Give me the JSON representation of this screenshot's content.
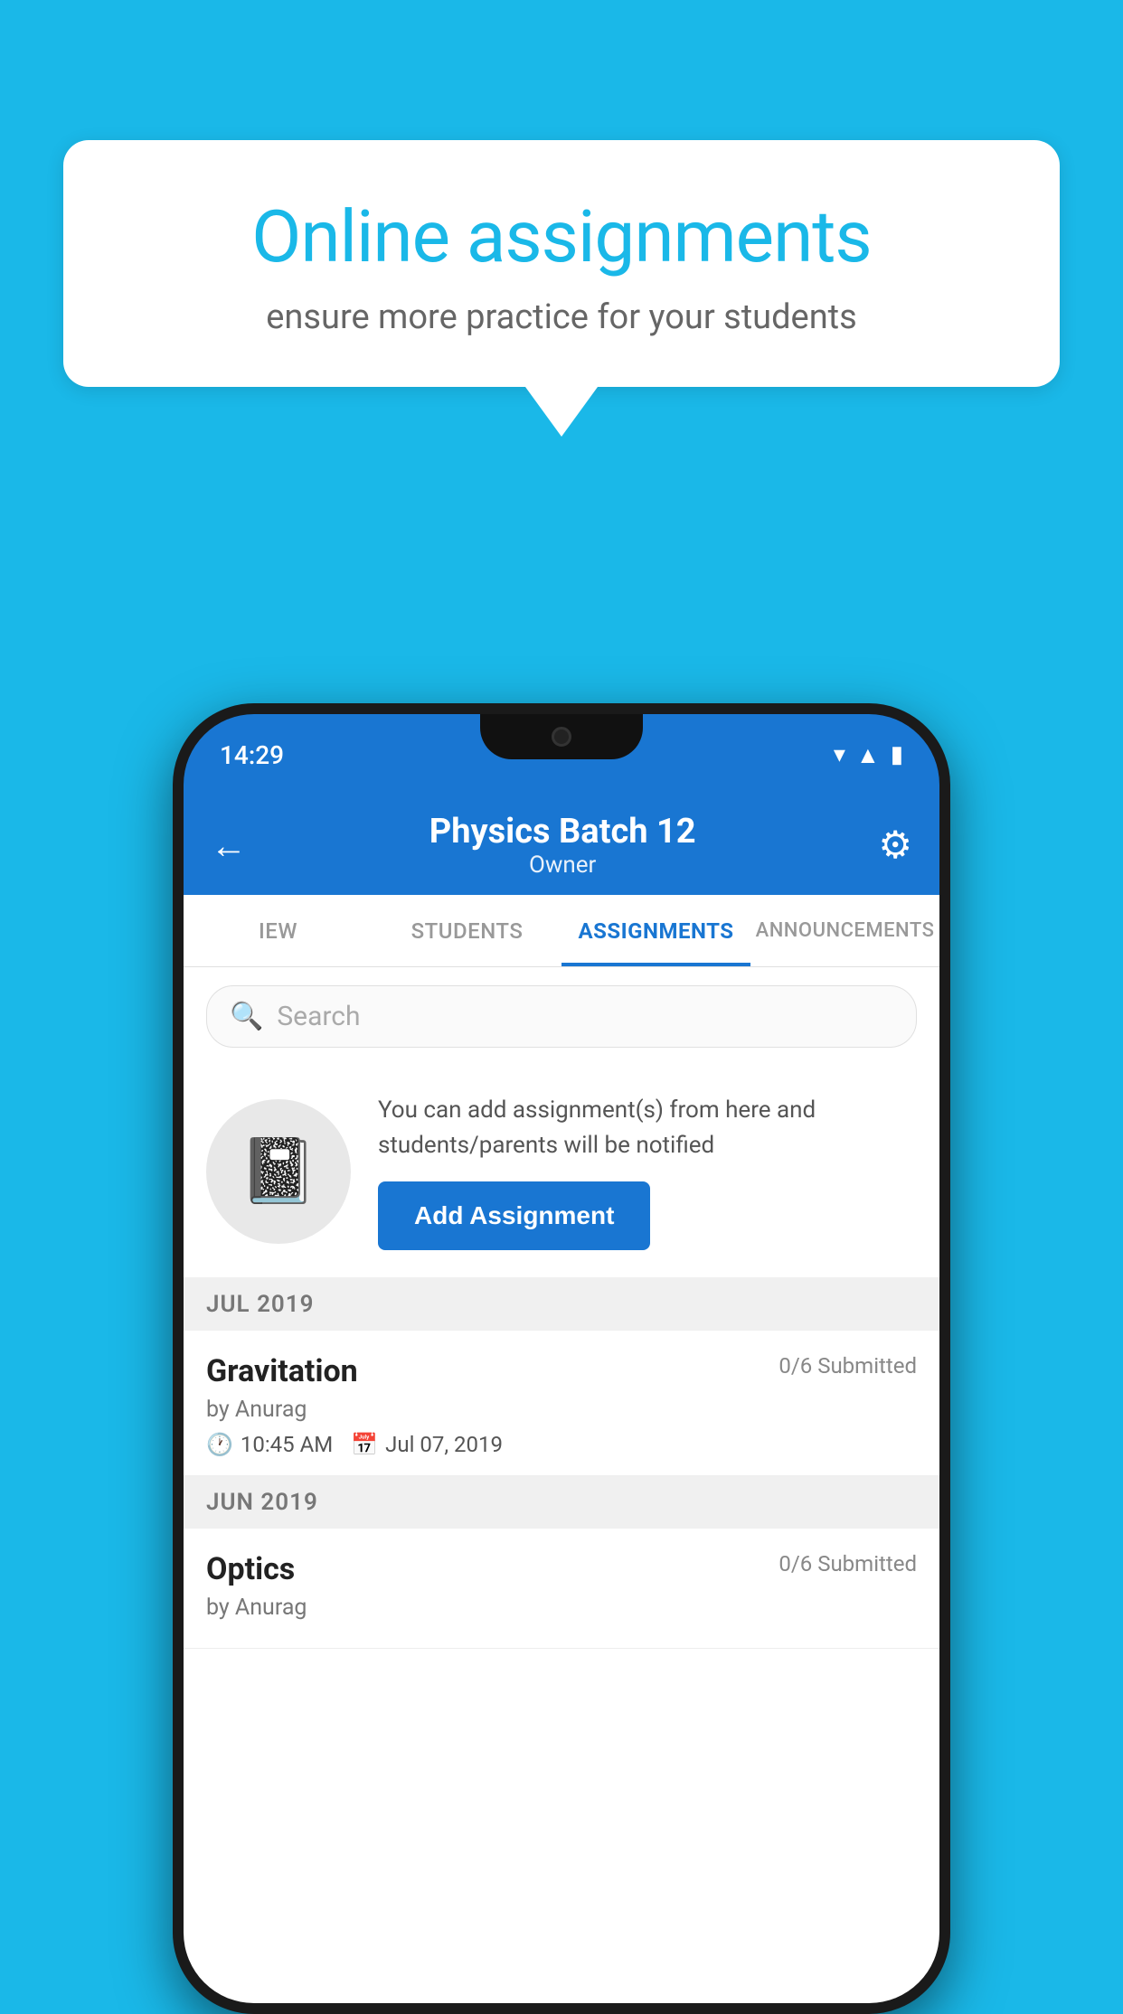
{
  "background_color": "#1ab8e8",
  "speech_bubble": {
    "title": "Online assignments",
    "subtitle": "ensure more practice for your students"
  },
  "phone": {
    "status_bar": {
      "time": "14:29",
      "icons": [
        "wifi",
        "signal",
        "battery"
      ]
    },
    "header": {
      "title": "Physics Batch 12",
      "subtitle": "Owner",
      "back_label": "←",
      "settings_label": "⚙"
    },
    "tabs": [
      {
        "label": "IEW",
        "active": false
      },
      {
        "label": "STUDENTS",
        "active": false
      },
      {
        "label": "ASSIGNMENTS",
        "active": true
      },
      {
        "label": "ANNOUNCEMENTS",
        "active": false
      }
    ],
    "search": {
      "placeholder": "Search"
    },
    "add_assignment": {
      "description": "You can add assignment(s) from here and students/parents will be notified",
      "button_label": "Add Assignment"
    },
    "months": [
      {
        "label": "JUL 2019",
        "assignments": [
          {
            "name": "Gravitation",
            "submitted": "0/6 Submitted",
            "by": "by Anurag",
            "time": "10:45 AM",
            "date": "Jul 07, 2019"
          }
        ]
      },
      {
        "label": "JUN 2019",
        "assignments": [
          {
            "name": "Optics",
            "submitted": "0/6 Submitted",
            "by": "by Anurag",
            "time": "",
            "date": ""
          }
        ]
      }
    ]
  }
}
